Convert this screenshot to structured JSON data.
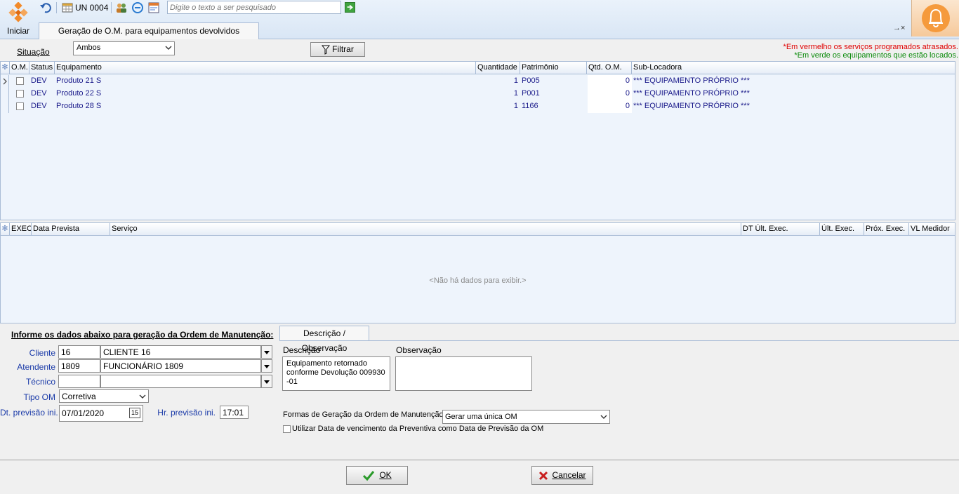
{
  "toolbar": {
    "start_label": "Iniciar",
    "unit_label": "UN 0004",
    "search_placeholder": "Digite o texto a ser pesquisado"
  },
  "tabs": {
    "main_tab": "Geração de O.M. para equipamentos devolvidos",
    "close_glyph": "→×"
  },
  "filter": {
    "situacao_label": "Situação",
    "situacao_value": "Ambos",
    "filter_button": "Filtrar"
  },
  "legend": {
    "red_text": "*Em vermelho os serviços programados atrasados.",
    "green_text": "*Em verde os equipamentos que estão locados.",
    "red_color": "#e00000",
    "green_color": "#0a8a0a"
  },
  "equipment_grid": {
    "columns": [
      "O.M.",
      "Status",
      "Equipamento",
      "Quantidade",
      "Patrimônio",
      "Qtd. O.M.",
      "Sub-Locadora"
    ],
    "rows": [
      {
        "status": "DEV",
        "equipamento": "Produto 21 S",
        "quantidade": "1",
        "patrimonio": "P005",
        "qtd_om": "0",
        "sub_locadora": "*** EQUIPAMENTO PRÓPRIO ***"
      },
      {
        "status": "DEV",
        "equipamento": "Produto 22 S",
        "quantidade": "1",
        "patrimonio": "P001",
        "qtd_om": "0",
        "sub_locadora": "*** EQUIPAMENTO PRÓPRIO ***"
      },
      {
        "status": "DEV",
        "equipamento": "Produto 28 S",
        "quantidade": "1",
        "patrimonio": "1166",
        "qtd_om": "0",
        "sub_locadora": "*** EQUIPAMENTO PRÓPRIO ***"
      }
    ]
  },
  "service_grid": {
    "columns": [
      "EXEC",
      "Data Prevista",
      "Serviço",
      "DT Últ. Exec.",
      "Últ. Exec.",
      "Próx. Exec.",
      "VL Medidor"
    ],
    "empty_text": "<Não há dados para exibir.>"
  },
  "form": {
    "title": "Informe os dados abaixo para geração da Ordem de Manutenção:",
    "cliente_label": "Cliente",
    "cliente_code": "16",
    "cliente_name": "CLIENTE  16",
    "atendente_label": "Atendente",
    "atendente_code": "1809",
    "atendente_name": "FUNCIONÁRIO  1809",
    "tecnico_label": "Técnico",
    "tecnico_code": "",
    "tecnico_name": "",
    "tipo_om_label": "Tipo OM",
    "tipo_om_value": "Corretiva",
    "dt_previsao_label": "Dt. previsão ini.",
    "dt_previsao_value": "07/01/2020",
    "calendar_glyph": "15",
    "hr_previsao_label": "Hr. previsão ini.",
    "hr_previsao_value": "17:01",
    "desc_tab": "Descrição / Observação",
    "descricao_label": "Descrição",
    "descricao_value": "Equipamento retornado conforme Devolução 009930 -01",
    "observacao_label": "Observação",
    "observacao_value": "",
    "formas_label": "Formas de Geração da Ordem de Manutenção",
    "formas_value": "Gerar uma única OM",
    "utilizar_label": "Utilizar Data de vencimento da Preventiva como Data de Previsão da OM"
  },
  "footer": {
    "ok_label": "OK",
    "cancel_label": "Cancelar"
  }
}
